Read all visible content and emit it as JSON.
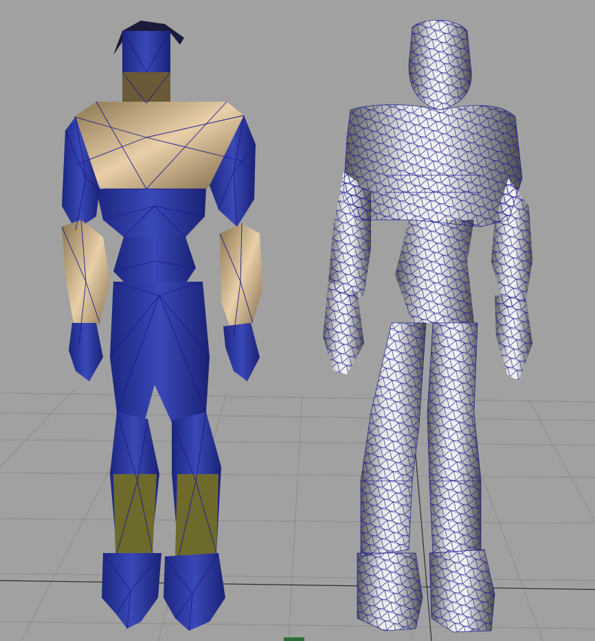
{
  "viewport": {
    "background_color": "#a1a1a1",
    "grid_color": "#8b8b8b",
    "grid_axis_color": "#2a2a2a",
    "wire_color": "#1a1a8c"
  },
  "models": [
    {
      "id": "low-poly-character",
      "shading": "flat-shaded",
      "primary_color": "#2d3aa0",
      "secondary_colors": [
        "#c8a77a",
        "#6b6428"
      ]
    },
    {
      "id": "high-poly-character",
      "shading": "smooth-shaded-wireframe",
      "primary_color": "#d8d8d8"
    }
  ]
}
